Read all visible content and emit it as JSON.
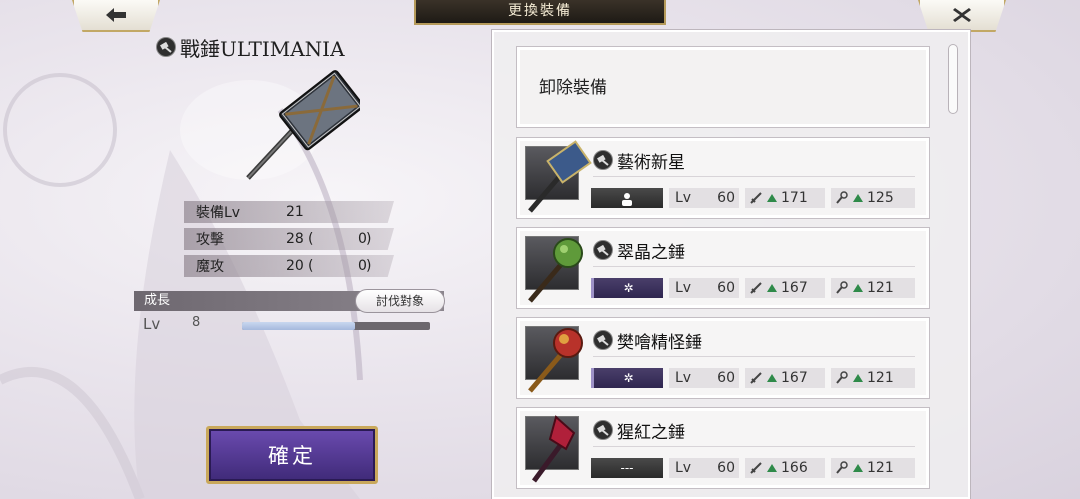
{
  "header": {
    "title": "更換裝備"
  },
  "current_weapon": {
    "name": "戰錘ULTIMANIA",
    "stats": [
      {
        "label": "裝備Lv",
        "value": "21",
        "paren_open": "",
        "bonus": "",
        "paren_close": ""
      },
      {
        "label": "攻擊",
        "value": "28",
        "paren_open": "(",
        "bonus": "0",
        "paren_close": ")"
      },
      {
        "label": "魔攻",
        "value": "20",
        "paren_open": "(",
        "bonus": "0",
        "paren_close": ")"
      }
    ],
    "growth_label": "成長",
    "target_button": "討伐對象",
    "lv_label": "Lv",
    "lv_value": "8",
    "lv_progress": 0.6
  },
  "confirm_button": "確定",
  "list": {
    "unequip_label": "卸除裝備",
    "items": [
      {
        "name": "藝術新星",
        "chip": "person",
        "lv_label": "Lv",
        "lv": "60",
        "atk": "171",
        "mag": "125"
      },
      {
        "name": "翠晶之錘",
        "chip": "✲",
        "lv_label": "Lv",
        "lv": "60",
        "atk": "167",
        "mag": "121"
      },
      {
        "name": "樊噲精怪錘",
        "chip": "✲",
        "lv_label": "Lv",
        "lv": "60",
        "atk": "167",
        "mag": "121"
      },
      {
        "name": "猩紅之錘",
        "chip": "---",
        "lv_label": "Lv",
        "lv": "60",
        "atk": "166",
        "mag": "121"
      }
    ]
  },
  "icons": {
    "back": "arrow-left-icon",
    "close": "close-icon",
    "weapon_type": "hammer-type-icon",
    "atk": "sword-icon",
    "mag": "magic-wand-icon",
    "stat_up": "triangle-up-icon"
  },
  "colors": {
    "accent_gold": "#c9a85b",
    "confirm_purple": "#5a3f9a",
    "stat_up_green": "#2f8a4a"
  }
}
